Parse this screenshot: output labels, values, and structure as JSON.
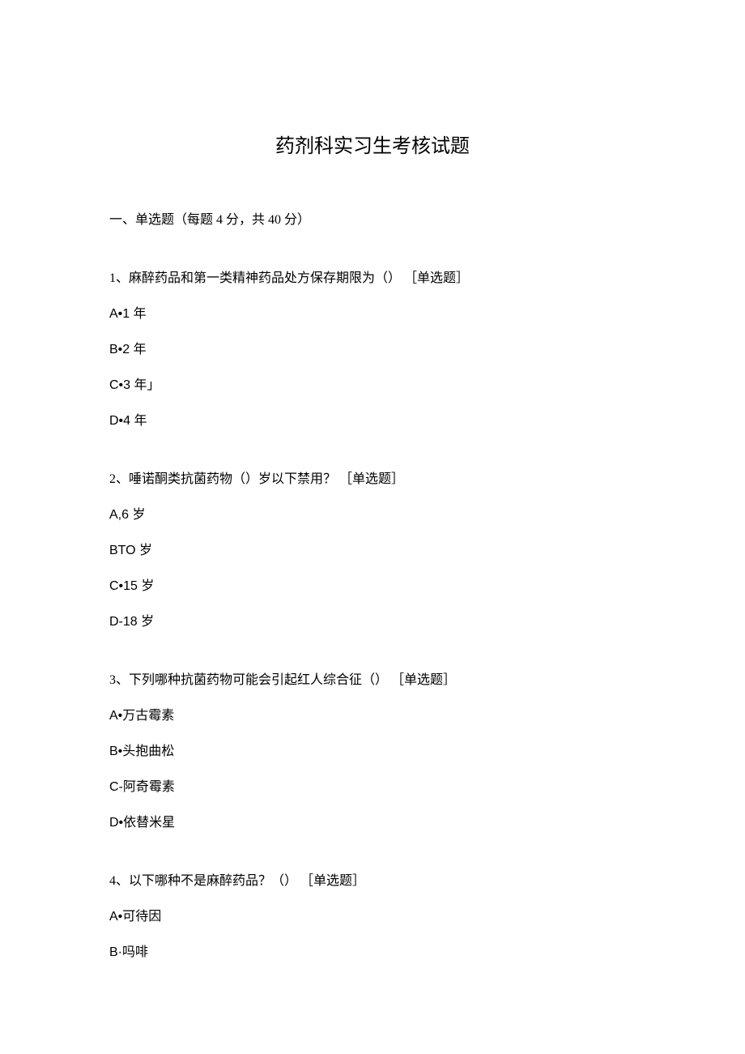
{
  "title": "药剂科实习生考核试题",
  "section_header": "一、单选题（每题 4 分，共 40 分）",
  "questions": [
    {
      "text": "1、麻醉药品和第一类精神药品处方保存期限为（） ［单选题］",
      "options": [
        "A•1 年",
        "B•2 年",
        "C•3 年」",
        "D•4 年"
      ]
    },
    {
      "text": "2、唾诺酮类抗菌药物（）岁以下禁用？ ［单选题］",
      "options": [
        "A,6 岁",
        "BTO 岁",
        "C•15 岁",
        "D-18 岁"
      ]
    },
    {
      "text": "3、下列哪种抗菌药物可能会引起红人综合征（） ［单选题］",
      "options": [
        "A•万古霉素",
        "B•头抱曲松",
        "C-阿奇霉素",
        "D•依替米星"
      ]
    },
    {
      "text": "4、以下哪种不是麻醉药品？（） ［单选题］",
      "options": [
        "A•可待因",
        "B·吗啡"
      ]
    }
  ]
}
